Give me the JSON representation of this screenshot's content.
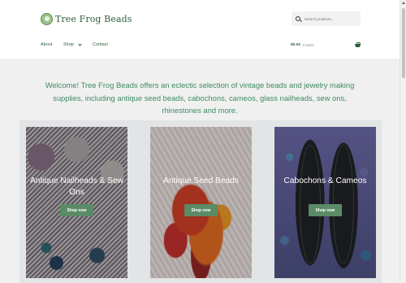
{
  "header": {
    "logo_text": "Tree Frog Beads",
    "search_placeholder": "Search products..."
  },
  "nav": {
    "items": [
      {
        "label": "About"
      },
      {
        "label": "Shop"
      },
      {
        "label": "Contact"
      }
    ]
  },
  "cart": {
    "total": "$0.00",
    "count": "0 items"
  },
  "welcome_text": "Welcome! Tree Frog Beads offers an eclectic selection of vintage beads and jewelry making supplies, including antique seed beads, cabochons, cameos, glass nailheads, sew ons, rhinestones and more.",
  "categories": [
    {
      "title": "Antique Nailheads & Sew Ons",
      "button": "Shop now"
    },
    {
      "title": "Antique Seed Beads",
      "button": "Shop now"
    },
    {
      "title": "Cabochons & Cameos",
      "button": "Shop now"
    }
  ],
  "colors": {
    "brand_green": "#2d5e3a",
    "accent_green": "#3e8b63",
    "button_green": "#5b8a66"
  }
}
